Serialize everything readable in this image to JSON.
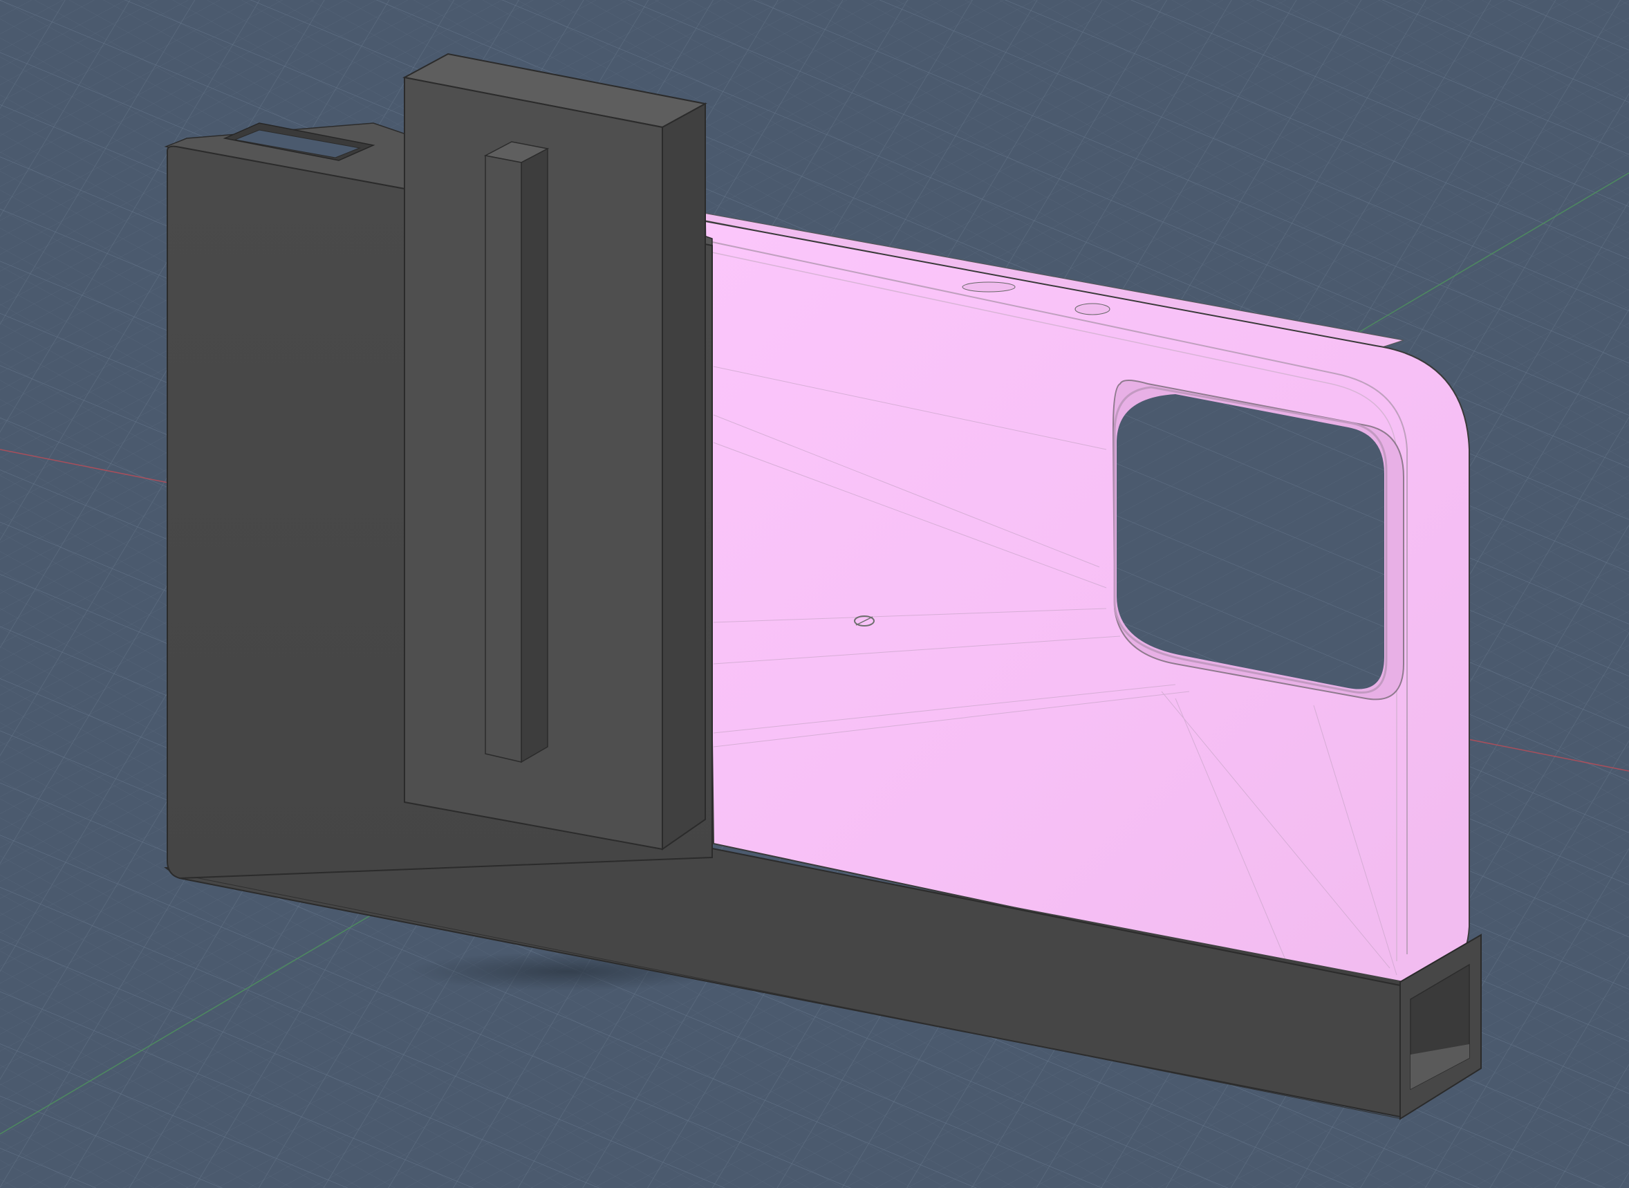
{
  "viewport": {
    "background": "#4b5a6e",
    "grid_color": "#6b7a8f",
    "axis_x_color": "#c94b55",
    "axis_y_color": "#4e9a5a"
  },
  "model": {
    "phone_case": {
      "color": "#f6c2f5",
      "camera_cutout_shape": "rounded-rectangle"
    },
    "holder_body": {
      "color": "#484848"
    },
    "clip_block": {
      "color": "#4d4d4d"
    },
    "tray": {
      "color": "#444444"
    },
    "sketch_outline_color": "#3fbec4"
  },
  "icons": {
    "origin_marker": "origin-marker-icon"
  }
}
